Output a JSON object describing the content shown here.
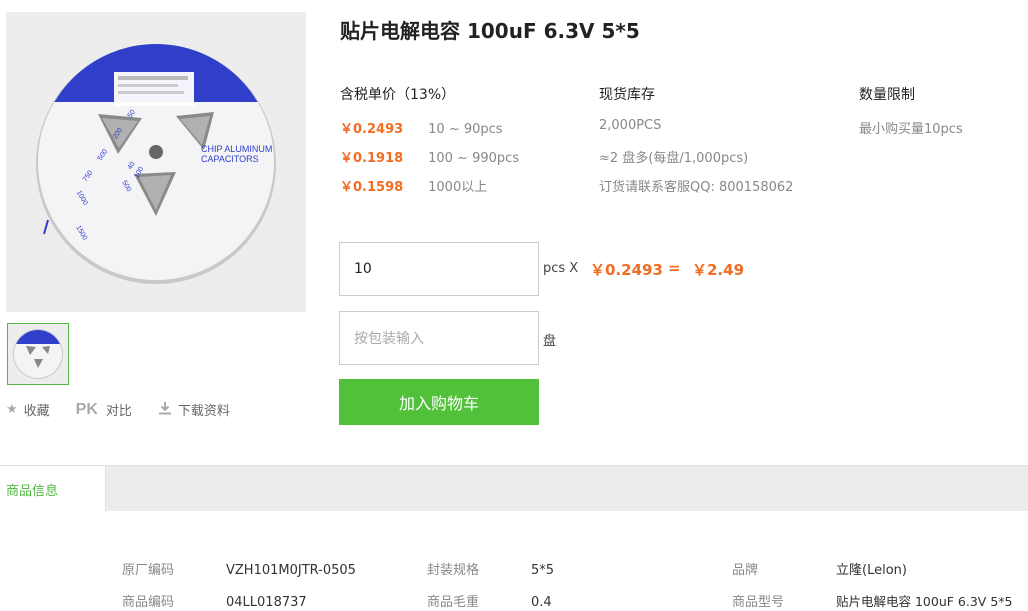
{
  "product": {
    "title": "贴片电解电容 100uF 6.3V 5*5",
    "image_text": {
      "line1": "CHIP ALUMINUM",
      "line2": "CAPACITORS",
      "reel_marks": [
        "50",
        "40",
        "100",
        "200",
        "500",
        "750",
        "1000",
        "1500",
        "500"
      ]
    }
  },
  "actions": {
    "favorite": "收藏",
    "pk_badge": "PK",
    "compare": "对比",
    "download": "下载资料"
  },
  "pricing": {
    "header": "含税单价（13%）",
    "tiers": [
      {
        "price": "￥0.2493",
        "range": "10 ~ 90pcs"
      },
      {
        "price": "￥0.1918",
        "range": "100 ~ 990pcs"
      },
      {
        "price": "￥0.1598",
        "range": "1000以上"
      }
    ]
  },
  "stock": {
    "header": "现货库存",
    "lines": [
      "2,000PCS",
      "≈2 盘多(每盘/1,000pcs)",
      "订货请联系客服QQ: 800158062"
    ]
  },
  "limit": {
    "header": "数量限制",
    "text": "最小购买量10pcs"
  },
  "order": {
    "qty_value": "10",
    "qty_unit": "pcs X",
    "unit_price": "￥0.2493",
    "equals": "=",
    "total": "￥2.49",
    "pkg_placeholder": "按包装输入",
    "pkg_unit": "盘",
    "cart_button": "加入购物车"
  },
  "tabs": {
    "active": "商品信息"
  },
  "specs": {
    "col1": [
      {
        "key": "原厂编码",
        "value": "VZH101M0JTR-0505"
      },
      {
        "key": "商品编码",
        "value": "04LL018737"
      }
    ],
    "col2": [
      {
        "key": "封装规格",
        "value": "5*5"
      },
      {
        "key": "商品毛重",
        "value": "0.4"
      }
    ],
    "col3": [
      {
        "key": "品牌",
        "value": "立隆(Lelon)"
      },
      {
        "key": "商品型号",
        "value": "贴片电解电容 100uF 6.3V 5*5"
      }
    ]
  },
  "colors": {
    "price": "#f26c22",
    "accent_green": "#52c13a",
    "reel_blue": "#2f3fc9"
  }
}
